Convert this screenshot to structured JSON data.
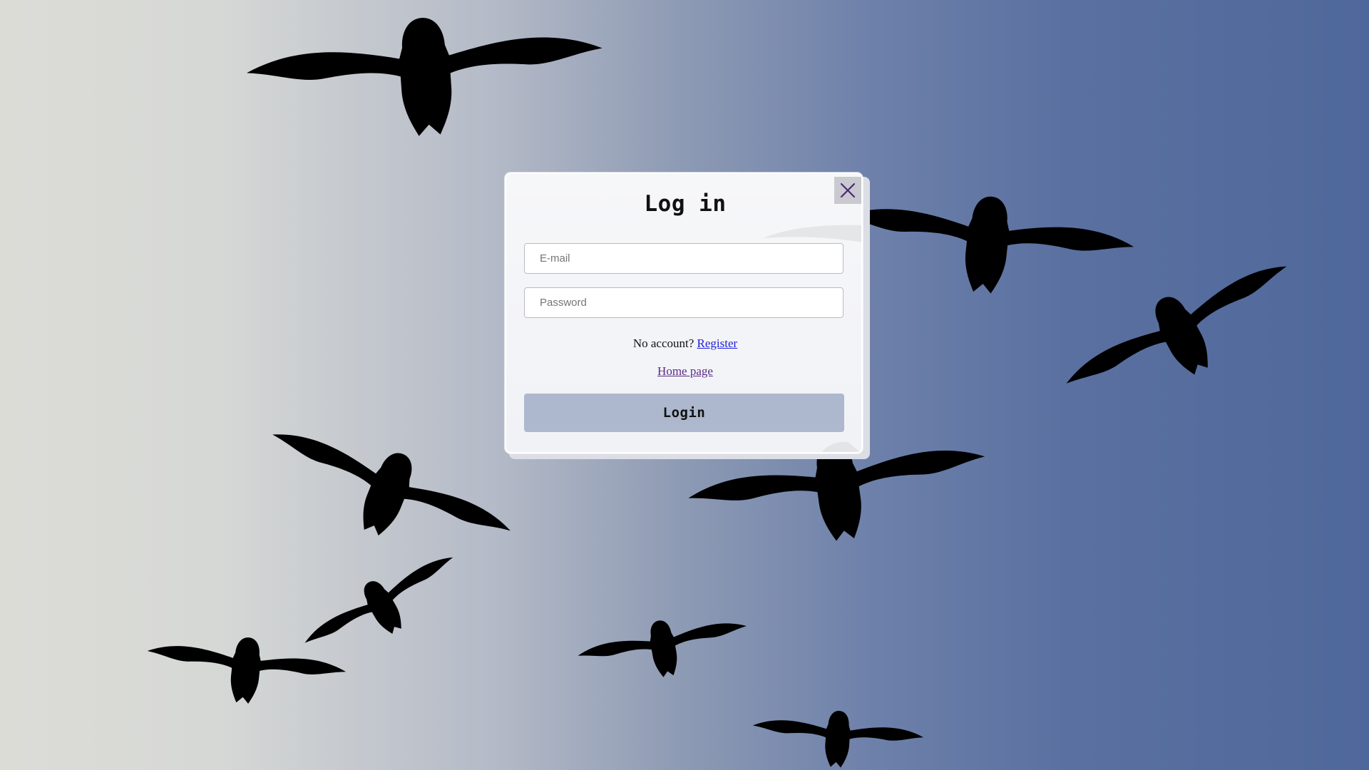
{
  "modal": {
    "title": "Log in",
    "close_icon": "close-icon"
  },
  "form": {
    "email_placeholder": "E-mail",
    "password_placeholder": "Password",
    "no_account_text": "No account? ",
    "register_label": "Register",
    "home_label": "Home page",
    "login_label": "Login"
  },
  "colors": {
    "gradient_left": "#dcdcd7",
    "gradient_right": "#4f689b",
    "login_button": "#adb8ce",
    "register_link": "#2020d8",
    "home_link": "#5a2a86",
    "close_button_bg": "#c9c9cf",
    "close_icon": "#4a2a7a"
  },
  "background": {
    "decoration": "flying-birds-silhouettes"
  }
}
